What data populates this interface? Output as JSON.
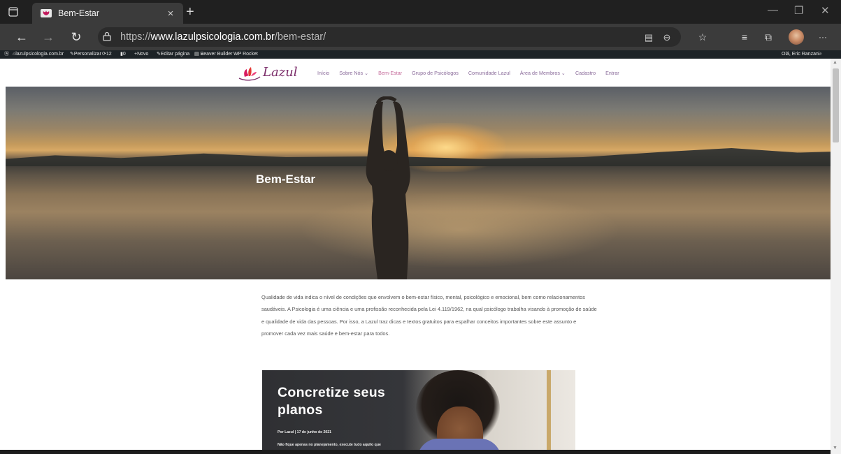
{
  "browser": {
    "tab_title": "Bem-Estar",
    "tab_close": "×",
    "new_tab": "+",
    "url_prefix": "https://",
    "url_host": "www.lazulpsicologia.com.br",
    "url_path": "/bem-estar/",
    "more_label": "···"
  },
  "wp_admin_bar": {
    "site": "lazulpsicologia.com.br",
    "customize": "Personalizar",
    "updates": "12",
    "comments": "0",
    "new": "Novo",
    "edit_page": "Editar página",
    "beaver": "Beaver Builder",
    "rocket": "WP Rocket",
    "greeting": "Olá, Eric Ranzani"
  },
  "site": {
    "logo_text": "Lazul",
    "nav": [
      {
        "label": "Início"
      },
      {
        "label": "Sobre Nós ⌄"
      },
      {
        "label": "Bem-Estar"
      },
      {
        "label": "Grupo de Psicólogos"
      },
      {
        "label": "Comunidade Lazul"
      },
      {
        "label": "Área de Membros ⌄"
      },
      {
        "label": "Cadastro"
      },
      {
        "label": "Entrar"
      }
    ]
  },
  "hero": {
    "title": "Bem-Estar"
  },
  "intro": {
    "text": "Qualidade de vida indica o nível de condições que envolvem o bem-estar físico, mental, psicológico e emocional, bem como relacionamentos saudáveis. A Psicologia é uma ciência e uma profissão reconhecida pela Lei 4.119/1962, na qual psicólogo trabalha visando à promoção de saúde e qualidade de vida das pessoas. Por isso, a Lazul traz dicas e textos gratuitos para espalhar conceitos importantes sobre este assunto e promover cada vez mais saúde e bem-estar para todos."
  },
  "post_card": {
    "title": "Concretize seus planos",
    "meta": "Por Lazul | 17 de junho de 2021",
    "excerpt": "Não fique apenas no planejamento, execute tudo aquilo que"
  },
  "colors": {
    "brand_purple": "#7b2d6a",
    "nav_text": "#8a6b9a",
    "nav_active": "#c46a9a"
  }
}
